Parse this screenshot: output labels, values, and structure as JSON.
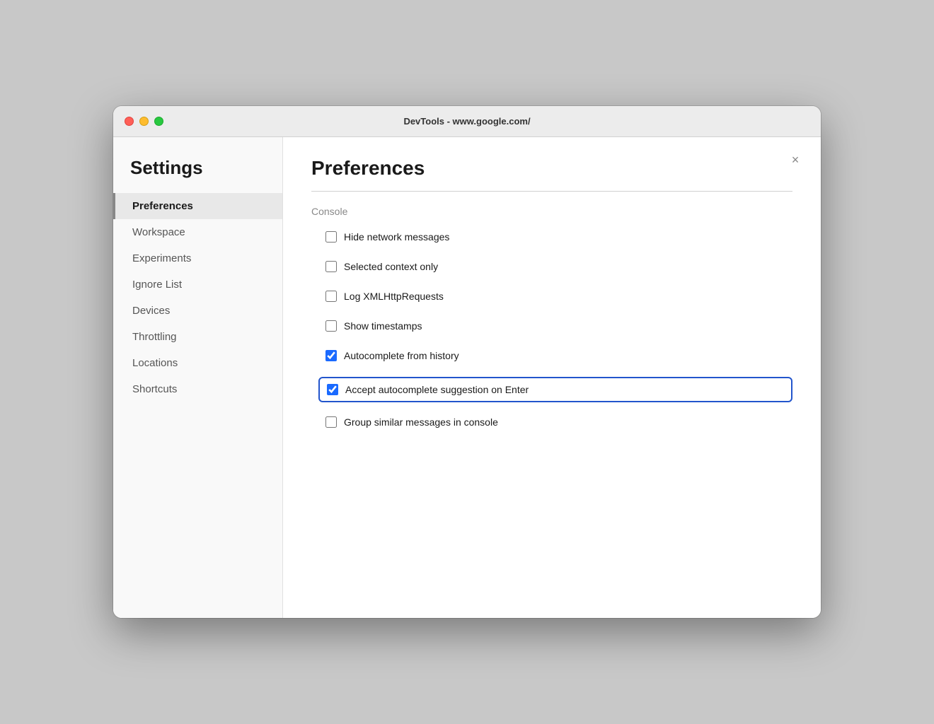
{
  "window": {
    "title": "DevTools - www.google.com/"
  },
  "sidebar": {
    "heading": "Settings",
    "items": [
      {
        "id": "preferences",
        "label": "Preferences",
        "active": true
      },
      {
        "id": "workspace",
        "label": "Workspace",
        "active": false
      },
      {
        "id": "experiments",
        "label": "Experiments",
        "active": false
      },
      {
        "id": "ignore-list",
        "label": "Ignore List",
        "active": false
      },
      {
        "id": "devices",
        "label": "Devices",
        "active": false
      },
      {
        "id": "throttling",
        "label": "Throttling",
        "active": false
      },
      {
        "id": "locations",
        "label": "Locations",
        "active": false
      },
      {
        "id": "shortcuts",
        "label": "Shortcuts",
        "active": false
      }
    ]
  },
  "main": {
    "title": "Preferences",
    "close_label": "×",
    "section": {
      "title": "Console",
      "checkboxes": [
        {
          "id": "hide-network",
          "label": "Hide network messages",
          "checked": false,
          "highlighted": false
        },
        {
          "id": "selected-context",
          "label": "Selected context only",
          "checked": false,
          "highlighted": false
        },
        {
          "id": "log-xml",
          "label": "Log XMLHttpRequests",
          "checked": false,
          "highlighted": false
        },
        {
          "id": "show-timestamps",
          "label": "Show timestamps",
          "checked": false,
          "highlighted": false
        },
        {
          "id": "autocomplete-history",
          "label": "Autocomplete from history",
          "checked": true,
          "highlighted": false
        },
        {
          "id": "autocomplete-enter",
          "label": "Accept autocomplete suggestion on Enter",
          "checked": true,
          "highlighted": true
        },
        {
          "id": "group-similar",
          "label": "Group similar messages in console",
          "checked": false,
          "highlighted": false
        }
      ]
    }
  },
  "colors": {
    "highlight_border": "#2255cc",
    "checked_accent": "#1a6aff"
  }
}
